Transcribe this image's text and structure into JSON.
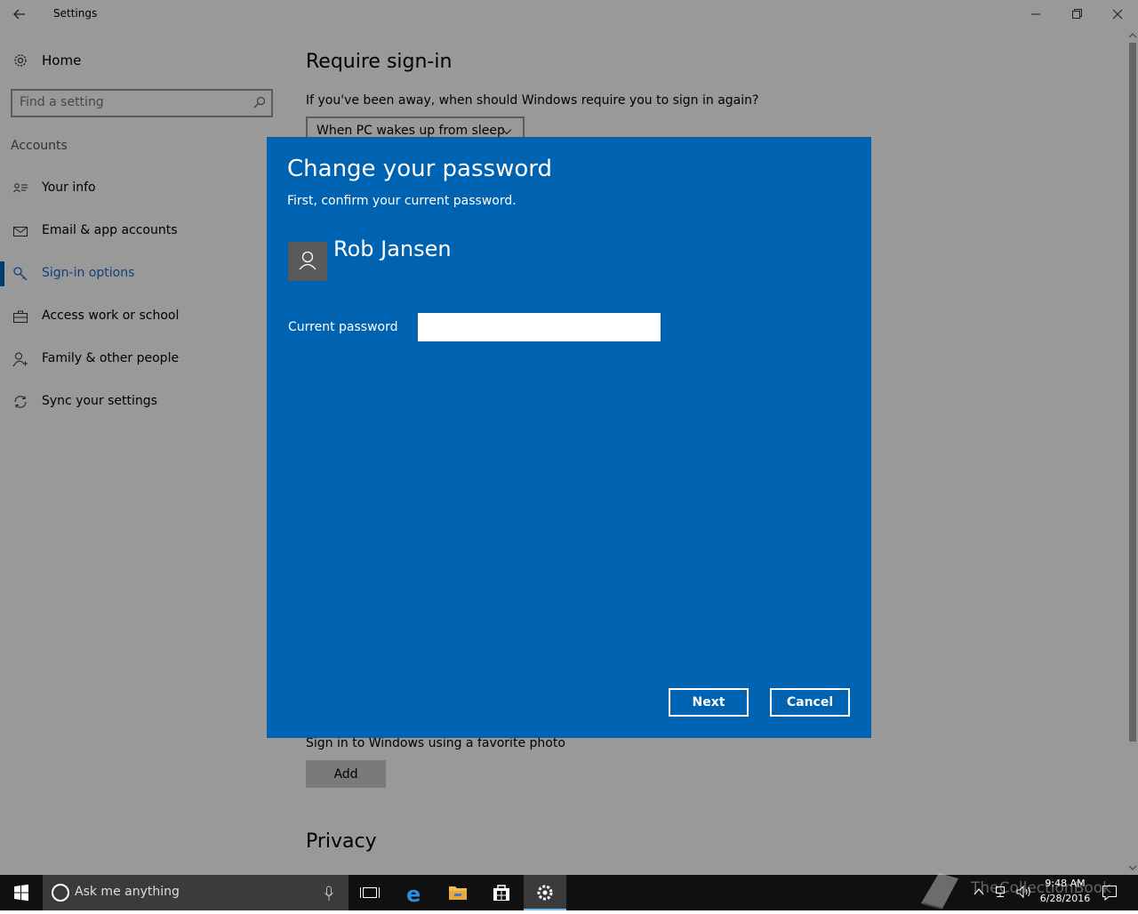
{
  "window": {
    "title": "Settings"
  },
  "sidebar": {
    "home_label": "Home",
    "search_placeholder": "Find a setting",
    "section_label": "Accounts",
    "items": [
      {
        "label": "Your info",
        "icon": "contact-card-icon"
      },
      {
        "label": "Email & app accounts",
        "icon": "mail-icon"
      },
      {
        "label": "Sign-in options",
        "icon": "key-icon",
        "active": true
      },
      {
        "label": "Access work or school",
        "icon": "briefcase-icon"
      },
      {
        "label": "Family & other people",
        "icon": "person-add-icon"
      },
      {
        "label": "Sync your settings",
        "icon": "sync-icon"
      }
    ]
  },
  "content": {
    "heading": "Require sign-in",
    "question": "If you've been away, when should Windows require you to sign in again?",
    "dropdown_value": "When PC wakes up from sleep",
    "picture_password_desc": "Sign in to Windows using a favorite photo",
    "add_label": "Add",
    "privacy_heading": "Privacy"
  },
  "dialog": {
    "title": "Change your password",
    "subtitle": "First, confirm your current password.",
    "user_name": "Rob Jansen",
    "password_label": "Current password",
    "password_value": "",
    "next_label": "Next",
    "cancel_label": "Cancel"
  },
  "taskbar": {
    "search_text": "Ask me anything",
    "time": "9:48 AM",
    "date": "6/28/2016",
    "watermark": "TheCollectionBook"
  },
  "colors": {
    "accent": "#0063b1",
    "active_link": "#1e6bd2",
    "taskbar": "#101010"
  }
}
